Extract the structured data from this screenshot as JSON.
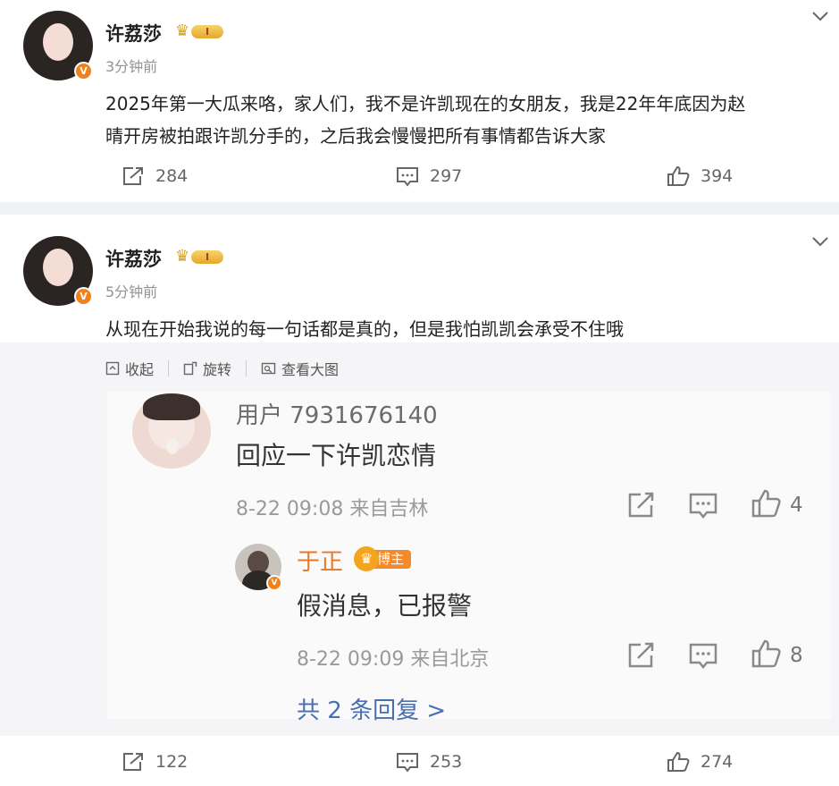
{
  "posts": [
    {
      "author": "许荔莎",
      "level_badge": "I",
      "verified_mark": "V",
      "time": "3分钟前",
      "text_lines": [
        "2025年第一大瓜来咯，家人们，我不是许凯现在的女朋友，我是22年年底因为赵",
        "晴开房被拍跟许凯分手的，之后我会慢慢把所有事情都告诉大家"
      ],
      "stats": {
        "repost": "284",
        "comment": "297",
        "like": "394"
      }
    },
    {
      "author": "许荔莎",
      "level_badge": "I",
      "verified_mark": "V",
      "time": "5分钟前",
      "text_lines": [
        "从现在开始我说的每一句话都是真的，但是我怕凯凯会承受不住哦"
      ],
      "media_tools": {
        "collapse": "收起",
        "rotate": "旋转",
        "view_large": "查看大图"
      },
      "stats": {
        "repost": "122",
        "comment": "253",
        "like": "274"
      }
    }
  ],
  "screenshot": {
    "comment": {
      "user": "用户 7931676140",
      "text": "回应一下许凯恋情",
      "meta": "8-22 09:08  来自吉林",
      "likes": "4"
    },
    "reply": {
      "user": "于正",
      "badge": "博主",
      "verified_mark": "V",
      "text": "假消息，已报警",
      "meta": "8-22 09:09  来自北京",
      "likes": "8"
    },
    "more_replies": "共 2 条回复 >"
  },
  "icons": [
    "repost-icon",
    "comment-icon",
    "like-icon",
    "chevron-down-icon",
    "collapse-icon",
    "rotate-icon",
    "view-large-icon",
    "share-icon",
    "crown-icon"
  ],
  "colors": {
    "accent_orange": "#f38119",
    "link_blue": "#4a6fb0",
    "level_gold": "#e6a62b"
  }
}
